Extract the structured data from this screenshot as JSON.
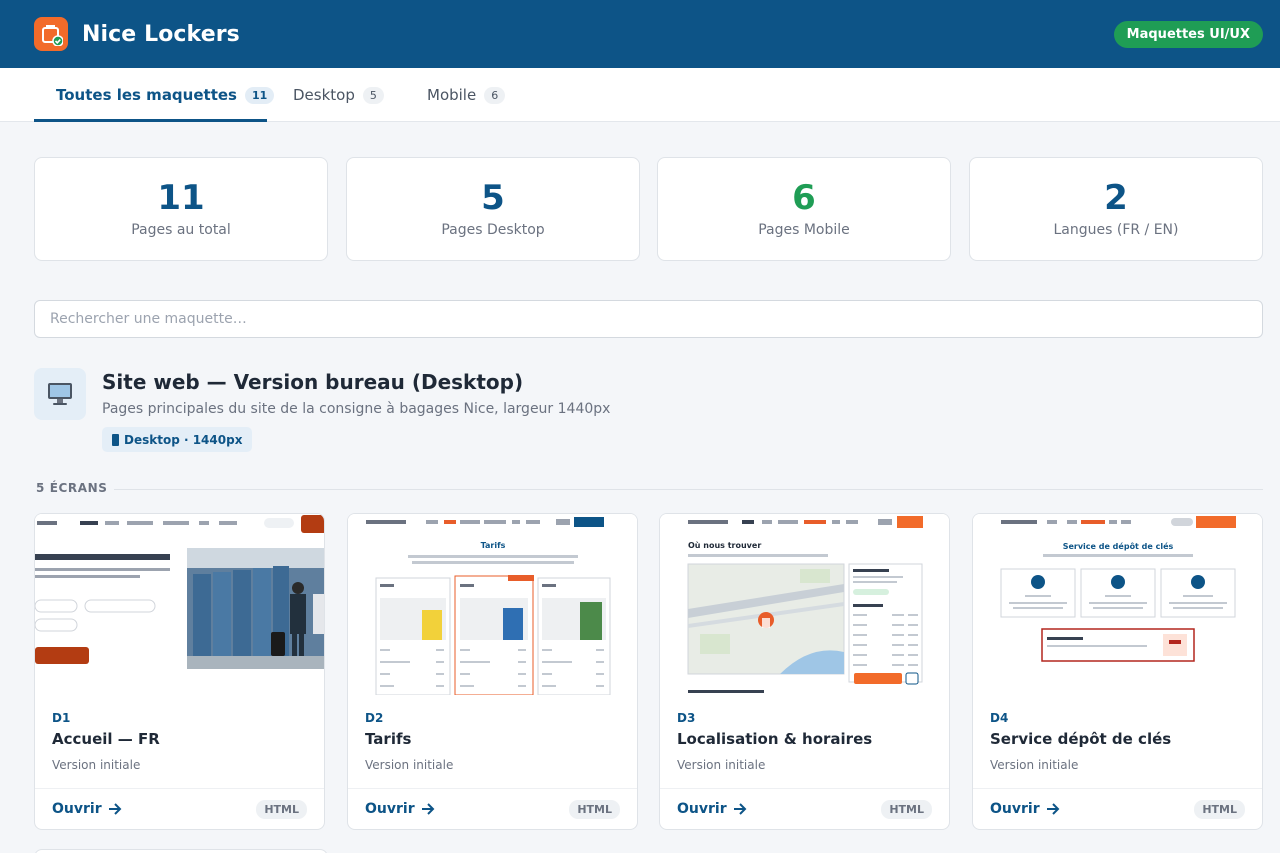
{
  "header": {
    "brand": "Nice Lockers",
    "badge": "Maquettes UI/UX"
  },
  "tabs": [
    {
      "label": "Toutes les maquettes",
      "count": "11"
    },
    {
      "label": "Desktop",
      "count": "5"
    },
    {
      "label": "Mobile",
      "count": "6"
    }
  ],
  "stats": [
    {
      "value": "11",
      "label": "Pages au total"
    },
    {
      "value": "5",
      "label": "Pages Desktop"
    },
    {
      "value": "6",
      "label": "Pages Mobile"
    },
    {
      "value": "2",
      "label": "Langues (FR / EN)"
    }
  ],
  "search": {
    "placeholder": "Rechercher une maquette…"
  },
  "section": {
    "title": "Site web — Version bureau (Desktop)",
    "description": "Pages principales du site de la consigne à bagages Nice, largeur 1440px",
    "badge": "Desktop · 1440px",
    "screens_label": "5 ÉCRANS"
  },
  "cards": [
    {
      "code": "D1",
      "title": "Accueil — FR",
      "version": "Version initiale",
      "open": "Ouvrir",
      "format": "HTML"
    },
    {
      "code": "D2",
      "title": "Tarifs",
      "version": "Version initiale",
      "open": "Ouvrir",
      "format": "HTML"
    },
    {
      "code": "D3",
      "title": "Localisation & horaires",
      "version": "Version initiale",
      "open": "Ouvrir",
      "format": "HTML"
    },
    {
      "code": "D4",
      "title": "Service dépôt de clés",
      "version": "Version initiale",
      "open": "Ouvrir",
      "format": "HTML"
    }
  ],
  "thumbs": {
    "d2_title": "Tarifs",
    "d3_title": "Où nous trouver",
    "d4_title": "Service de dépôt de clés"
  },
  "colors": {
    "primary": "#0d5487",
    "accent": "#f26b2a",
    "success": "#1f9d55"
  },
  "icons": {
    "logo": "locker-check-icon",
    "section": "desktop-monitor-icon",
    "open": "arrow-right-icon"
  }
}
